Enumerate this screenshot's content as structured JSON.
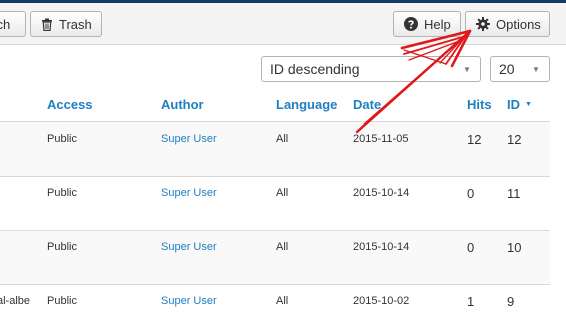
{
  "toolbar": {
    "batch_label": "Batch",
    "trash_label": "Trash",
    "help_label": "Help",
    "options_label": "Options"
  },
  "filters": {
    "order_value": "ID descending",
    "limit_value": "20"
  },
  "table": {
    "headers": {
      "access": "Access",
      "author": "Author",
      "language": "Language",
      "date": "Date",
      "hits": "Hits",
      "id": "ID"
    },
    "rows": [
      {
        "title_fragment": "",
        "access": "Public",
        "author": "Super User",
        "language": "All",
        "date": "2015-11-05",
        "hits": "12",
        "id": "12"
      },
      {
        "title_fragment": "",
        "access": "Public",
        "author": "Super User",
        "language": "All",
        "date": "2015-10-14",
        "hits": "0",
        "id": "11"
      },
      {
        "title_fragment": "",
        "access": "Public",
        "author": "Super User",
        "language": "All",
        "date": "2015-10-14",
        "hits": "0",
        "id": "10"
      },
      {
        "title_fragment": "al-albe",
        "access": "Public",
        "author": "Super User",
        "language": "All",
        "date": "2015-10-02",
        "hits": "1",
        "id": "9"
      }
    ]
  },
  "colors": {
    "link": "#1f7fc0",
    "annotation_arrow": "#e0181b",
    "top_bar": "#1a3867"
  },
  "icons": {
    "trash": "trash-icon",
    "help": "question-circle-icon",
    "options": "gear-icon",
    "sort": "sort-desc-icon"
  }
}
